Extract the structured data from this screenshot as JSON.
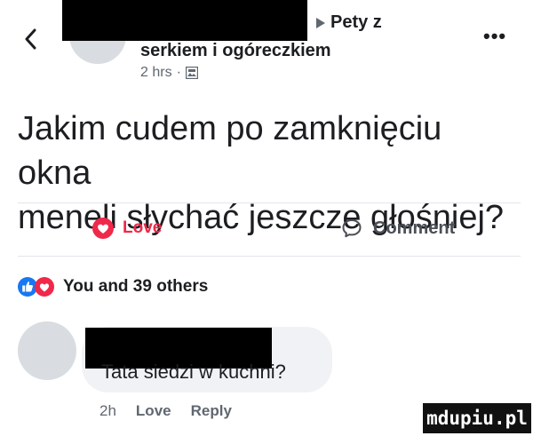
{
  "header": {
    "back_icon": "chevron-left-icon",
    "page_name_tail": "Pety z",
    "page_name_line2": "serkiem i ogóreczkiem",
    "time": "2 hrs",
    "separator": "·",
    "visibility_icon": "photo-icon",
    "more_label": "•••"
  },
  "post": {
    "text_line1": "Jakim cudem po zamknięciu okna",
    "text_line2": "meneli słychać jeszcze głośniej?"
  },
  "actions": {
    "love_label": "Love",
    "comment_label": "Comment",
    "love_color": "#f02849"
  },
  "reactions": {
    "summary": "You and 39 others",
    "like_color": "#1877f2",
    "love_color": "#f02849"
  },
  "comment": {
    "text": "Tata siedzi w kuchni?",
    "time": "2h",
    "love_label": "Love",
    "reply_label": "Reply"
  },
  "watermark": {
    "text": "mdupiu.pl"
  }
}
